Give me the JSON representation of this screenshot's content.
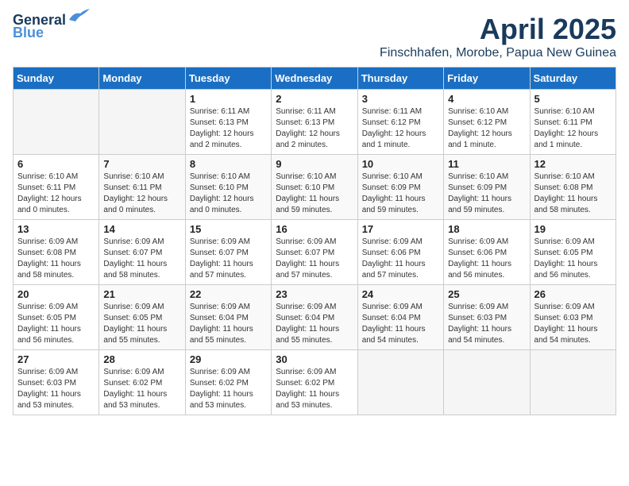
{
  "logo": {
    "line1": "General",
    "line2": "Blue"
  },
  "title": "April 2025",
  "location": "Finschhafen, Morobe, Papua New Guinea",
  "weekdays": [
    "Sunday",
    "Monday",
    "Tuesday",
    "Wednesday",
    "Thursday",
    "Friday",
    "Saturday"
  ],
  "weeks": [
    [
      {
        "day": "",
        "info": ""
      },
      {
        "day": "",
        "info": ""
      },
      {
        "day": "1",
        "info": "Sunrise: 6:11 AM\nSunset: 6:13 PM\nDaylight: 12 hours\nand 2 minutes."
      },
      {
        "day": "2",
        "info": "Sunrise: 6:11 AM\nSunset: 6:13 PM\nDaylight: 12 hours\nand 2 minutes."
      },
      {
        "day": "3",
        "info": "Sunrise: 6:11 AM\nSunset: 6:12 PM\nDaylight: 12 hours\nand 1 minute."
      },
      {
        "day": "4",
        "info": "Sunrise: 6:10 AM\nSunset: 6:12 PM\nDaylight: 12 hours\nand 1 minute."
      },
      {
        "day": "5",
        "info": "Sunrise: 6:10 AM\nSunset: 6:11 PM\nDaylight: 12 hours\nand 1 minute."
      }
    ],
    [
      {
        "day": "6",
        "info": "Sunrise: 6:10 AM\nSunset: 6:11 PM\nDaylight: 12 hours\nand 0 minutes."
      },
      {
        "day": "7",
        "info": "Sunrise: 6:10 AM\nSunset: 6:11 PM\nDaylight: 12 hours\nand 0 minutes."
      },
      {
        "day": "8",
        "info": "Sunrise: 6:10 AM\nSunset: 6:10 PM\nDaylight: 12 hours\nand 0 minutes."
      },
      {
        "day": "9",
        "info": "Sunrise: 6:10 AM\nSunset: 6:10 PM\nDaylight: 11 hours\nand 59 minutes."
      },
      {
        "day": "10",
        "info": "Sunrise: 6:10 AM\nSunset: 6:09 PM\nDaylight: 11 hours\nand 59 minutes."
      },
      {
        "day": "11",
        "info": "Sunrise: 6:10 AM\nSunset: 6:09 PM\nDaylight: 11 hours\nand 59 minutes."
      },
      {
        "day": "12",
        "info": "Sunrise: 6:10 AM\nSunset: 6:08 PM\nDaylight: 11 hours\nand 58 minutes."
      }
    ],
    [
      {
        "day": "13",
        "info": "Sunrise: 6:09 AM\nSunset: 6:08 PM\nDaylight: 11 hours\nand 58 minutes."
      },
      {
        "day": "14",
        "info": "Sunrise: 6:09 AM\nSunset: 6:07 PM\nDaylight: 11 hours\nand 58 minutes."
      },
      {
        "day": "15",
        "info": "Sunrise: 6:09 AM\nSunset: 6:07 PM\nDaylight: 11 hours\nand 57 minutes."
      },
      {
        "day": "16",
        "info": "Sunrise: 6:09 AM\nSunset: 6:07 PM\nDaylight: 11 hours\nand 57 minutes."
      },
      {
        "day": "17",
        "info": "Sunrise: 6:09 AM\nSunset: 6:06 PM\nDaylight: 11 hours\nand 57 minutes."
      },
      {
        "day": "18",
        "info": "Sunrise: 6:09 AM\nSunset: 6:06 PM\nDaylight: 11 hours\nand 56 minutes."
      },
      {
        "day": "19",
        "info": "Sunrise: 6:09 AM\nSunset: 6:05 PM\nDaylight: 11 hours\nand 56 minutes."
      }
    ],
    [
      {
        "day": "20",
        "info": "Sunrise: 6:09 AM\nSunset: 6:05 PM\nDaylight: 11 hours\nand 56 minutes."
      },
      {
        "day": "21",
        "info": "Sunrise: 6:09 AM\nSunset: 6:05 PM\nDaylight: 11 hours\nand 55 minutes."
      },
      {
        "day": "22",
        "info": "Sunrise: 6:09 AM\nSunset: 6:04 PM\nDaylight: 11 hours\nand 55 minutes."
      },
      {
        "day": "23",
        "info": "Sunrise: 6:09 AM\nSunset: 6:04 PM\nDaylight: 11 hours\nand 55 minutes."
      },
      {
        "day": "24",
        "info": "Sunrise: 6:09 AM\nSunset: 6:04 PM\nDaylight: 11 hours\nand 54 minutes."
      },
      {
        "day": "25",
        "info": "Sunrise: 6:09 AM\nSunset: 6:03 PM\nDaylight: 11 hours\nand 54 minutes."
      },
      {
        "day": "26",
        "info": "Sunrise: 6:09 AM\nSunset: 6:03 PM\nDaylight: 11 hours\nand 54 minutes."
      }
    ],
    [
      {
        "day": "27",
        "info": "Sunrise: 6:09 AM\nSunset: 6:03 PM\nDaylight: 11 hours\nand 53 minutes."
      },
      {
        "day": "28",
        "info": "Sunrise: 6:09 AM\nSunset: 6:02 PM\nDaylight: 11 hours\nand 53 minutes."
      },
      {
        "day": "29",
        "info": "Sunrise: 6:09 AM\nSunset: 6:02 PM\nDaylight: 11 hours\nand 53 minutes."
      },
      {
        "day": "30",
        "info": "Sunrise: 6:09 AM\nSunset: 6:02 PM\nDaylight: 11 hours\nand 53 minutes."
      },
      {
        "day": "",
        "info": ""
      },
      {
        "day": "",
        "info": ""
      },
      {
        "day": "",
        "info": ""
      }
    ]
  ]
}
